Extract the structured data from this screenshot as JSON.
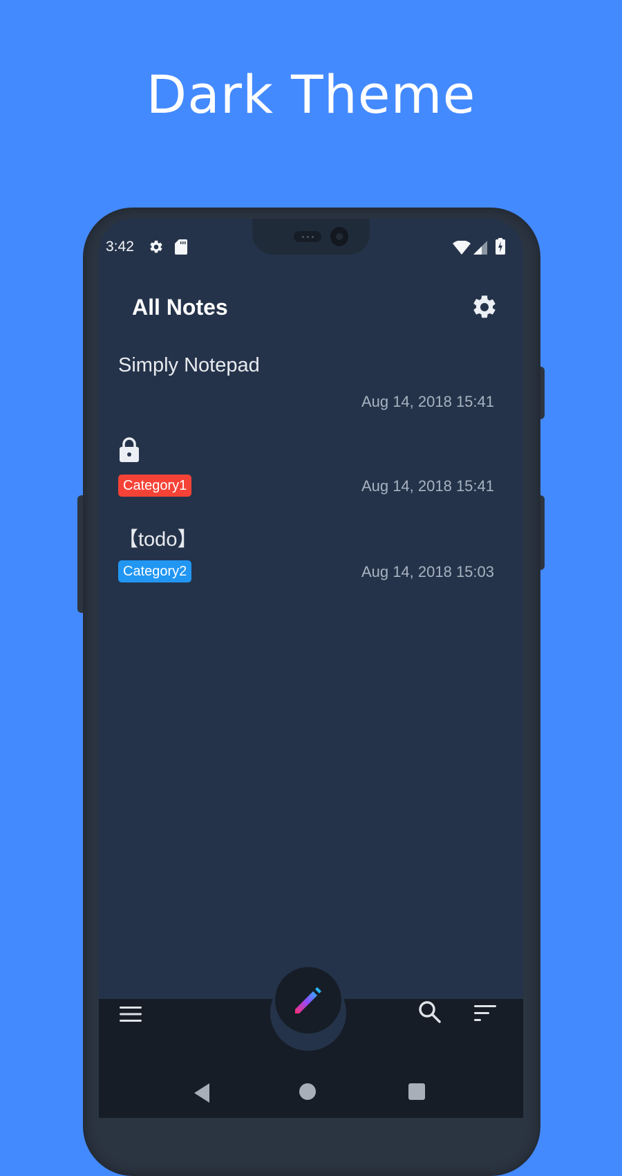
{
  "promo": {
    "title": "Dark Theme"
  },
  "status_bar": {
    "time": "3:42",
    "left_icons": [
      "gear-icon",
      "sd-card-icon"
    ],
    "right_icons": [
      "wifi-icon",
      "cellular-signal-icon",
      "battery-charging-icon"
    ]
  },
  "app_bar": {
    "title": "All Notes",
    "settings_icon": "gear-icon"
  },
  "notes": [
    {
      "title": "Simply Notepad",
      "locked": false,
      "category": null,
      "date": "Aug 14, 2018 15:41"
    },
    {
      "title": "",
      "locked": true,
      "category": "Category1",
      "category_color": "#f44336",
      "date": "Aug 14, 2018 15:41"
    },
    {
      "title": "【todo】",
      "locked": false,
      "category": "Category2",
      "category_color": "#2196f3",
      "date": "Aug 14, 2018 15:03"
    }
  ],
  "bottom_bar": {
    "menu_icon": "hamburger-menu-icon",
    "fab_icon": "pencil-icon",
    "search_icon": "search-icon",
    "sort_icon": "sort-icon"
  },
  "nav_bar": {
    "buttons": [
      "back",
      "home",
      "recents"
    ]
  },
  "colors": {
    "background": "#448aff",
    "screen": "#25334a",
    "bottom_bar": "#161d27",
    "text_primary": "#e8ebef",
    "text_secondary": "#a8b3c1",
    "fab_gradient_start": "#ff2d6f",
    "fab_gradient_end": "#29b6f6"
  }
}
